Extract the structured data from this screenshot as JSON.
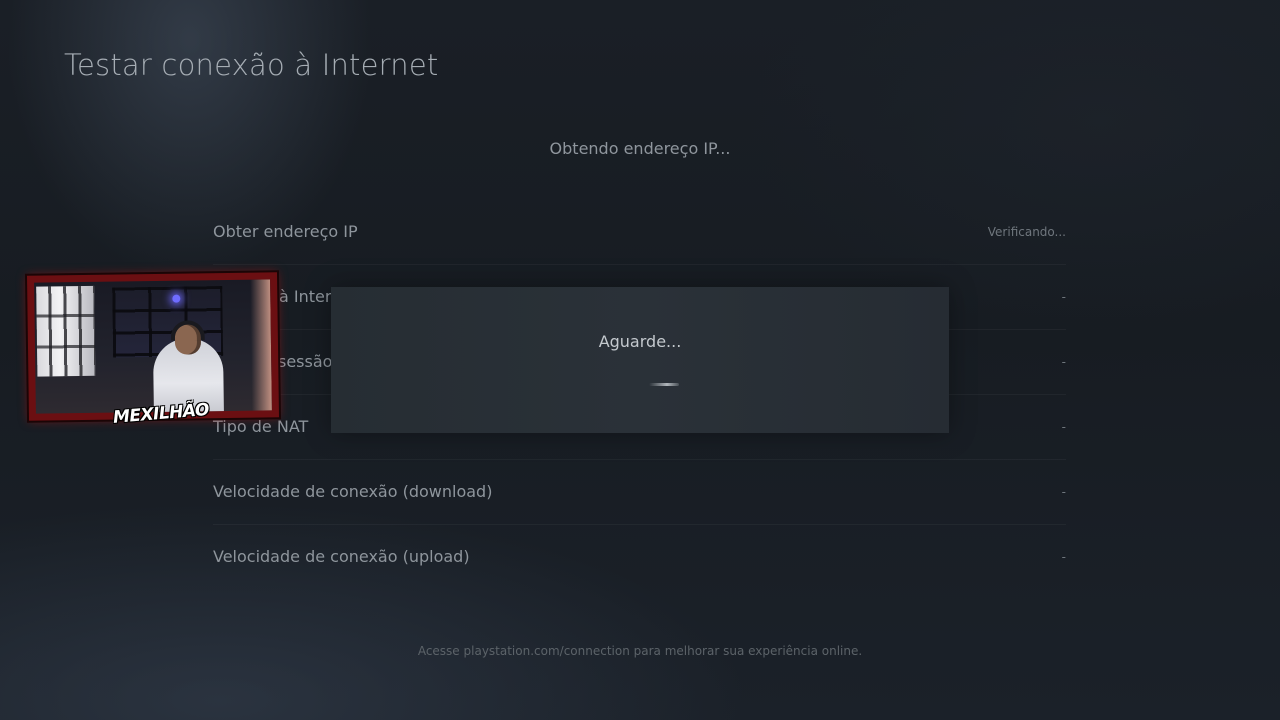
{
  "header": {
    "title": "Testar conexão à Internet"
  },
  "status": {
    "text": "Obtendo endereço IP..."
  },
  "tests": [
    {
      "label": "Obter endereço IP",
      "value": "Verificando..."
    },
    {
      "label": "à Interr",
      "value": "-"
    },
    {
      "label": "sessão",
      "value": "-"
    },
    {
      "label": "Tipo de NAT",
      "value": "-"
    },
    {
      "label": "Velocidade de conexão (download)",
      "value": "-"
    },
    {
      "label": "Velocidade de conexão (upload)",
      "value": "-"
    }
  ],
  "dialog": {
    "text": "Aguarde..."
  },
  "footer": {
    "text": "Acesse playstation.com/connection para melhorar sua experiência online."
  },
  "overlay": {
    "webcam_logo": "MEXILHÃO"
  }
}
